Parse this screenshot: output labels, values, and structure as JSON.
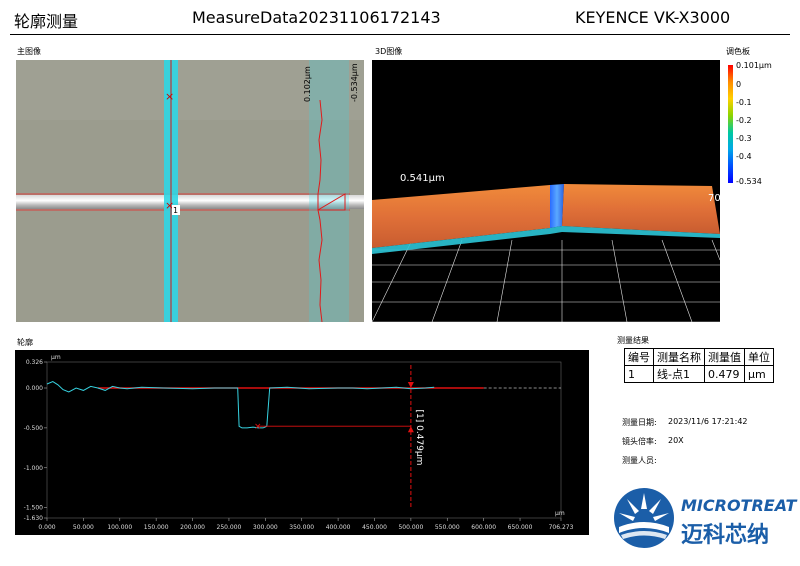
{
  "header": {
    "title": "轮廓测量",
    "file_name": "MeasureData20231106172143",
    "instrument": "KEYENCE VK-X3000"
  },
  "main_image": {
    "label": "主图像",
    "marker_label": "1",
    "right_axis_labels": [
      "0.102μm",
      "-0.534μm"
    ]
  },
  "view3d": {
    "label": "3D图像",
    "height_label": "0.541μm",
    "edge_label": "70"
  },
  "colorbar": {
    "label": "调色板",
    "ticks": [
      "0.101μm",
      "0",
      "-0.1",
      "-0.2",
      "-0.3",
      "-0.4",
      "-0.534"
    ],
    "colors": [
      "#ff0000",
      "#ff8c00",
      "#ffd000",
      "#8cd400",
      "#00c8a0",
      "#00a8e8",
      "#0050ff",
      "#0000ff"
    ]
  },
  "profile": {
    "label": "轮廓",
    "unit": "μm",
    "annotation": "[1] 0.479μm"
  },
  "chart_data": {
    "type": "line",
    "title": "",
    "xlabel": "μm",
    "ylabel": "μm",
    "xlim": [
      0,
      706.273
    ],
    "ylim": [
      -1.63,
      0.326
    ],
    "x_ticks": [
      "0.000",
      "50.000",
      "100.000",
      "150.000",
      "200.000",
      "250.000",
      "300.000",
      "350.000",
      "400.000",
      "450.000",
      "500.000",
      "550.000",
      "600.000",
      "650.000",
      "706.273"
    ],
    "y_ticks": [
      "0.326",
      "0.000",
      "-0.500",
      "-1.000",
      "-1.500",
      "-1.630"
    ],
    "series": [
      {
        "color": "#36d2e0",
        "x": [
          0,
          8,
          15,
          22,
          30,
          40,
          50,
          60,
          70,
          80,
          90,
          100,
          110,
          130,
          160,
          200,
          230,
          250,
          262,
          264,
          268,
          275,
          283,
          290,
          297,
          302,
          306,
          330,
          360,
          400,
          420,
          440,
          460,
          480,
          500,
          520,
          532
        ],
        "y": [
          0.05,
          0.08,
          0.04,
          -0.02,
          -0.05,
          0.0,
          -0.03,
          0.02,
          0.0,
          -0.03,
          0.02,
          0.0,
          -0.01,
          0.01,
          0.0,
          -0.01,
          0.0,
          0.0,
          0.0,
          -0.48,
          -0.5,
          -0.5,
          -0.49,
          -0.5,
          -0.5,
          -0.48,
          0.0,
          0.01,
          -0.01,
          0.0,
          0.0,
          -0.01,
          0.0,
          0.01,
          -0.01,
          0.0,
          0.01
        ]
      }
    ],
    "reference_line": {
      "color": "#e01010",
      "y": 0.0,
      "x_range": [
        70,
        600
      ]
    },
    "measurement": {
      "x": 500,
      "y_top": 0.0,
      "y_bottom": -0.479,
      "point_x": 290,
      "point_y": -0.479,
      "value": "0.479μm"
    }
  },
  "results": {
    "label": "测量结果",
    "headers": [
      "编号",
      "测量名称",
      "测量值",
      "单位"
    ],
    "rows": [
      [
        "1",
        "线-点1",
        "0.479",
        "μm"
      ]
    ]
  },
  "info": {
    "date_label": "测量日期:",
    "date_value": "2023/11/6 17:21:42",
    "lens_label": "镜头倍率:",
    "lens_value": "20X",
    "operator_label": "测量人员:",
    "operator_value": ""
  },
  "logo": {
    "text_en": "MICROTREAT",
    "text_cn": "迈科芯纳"
  }
}
